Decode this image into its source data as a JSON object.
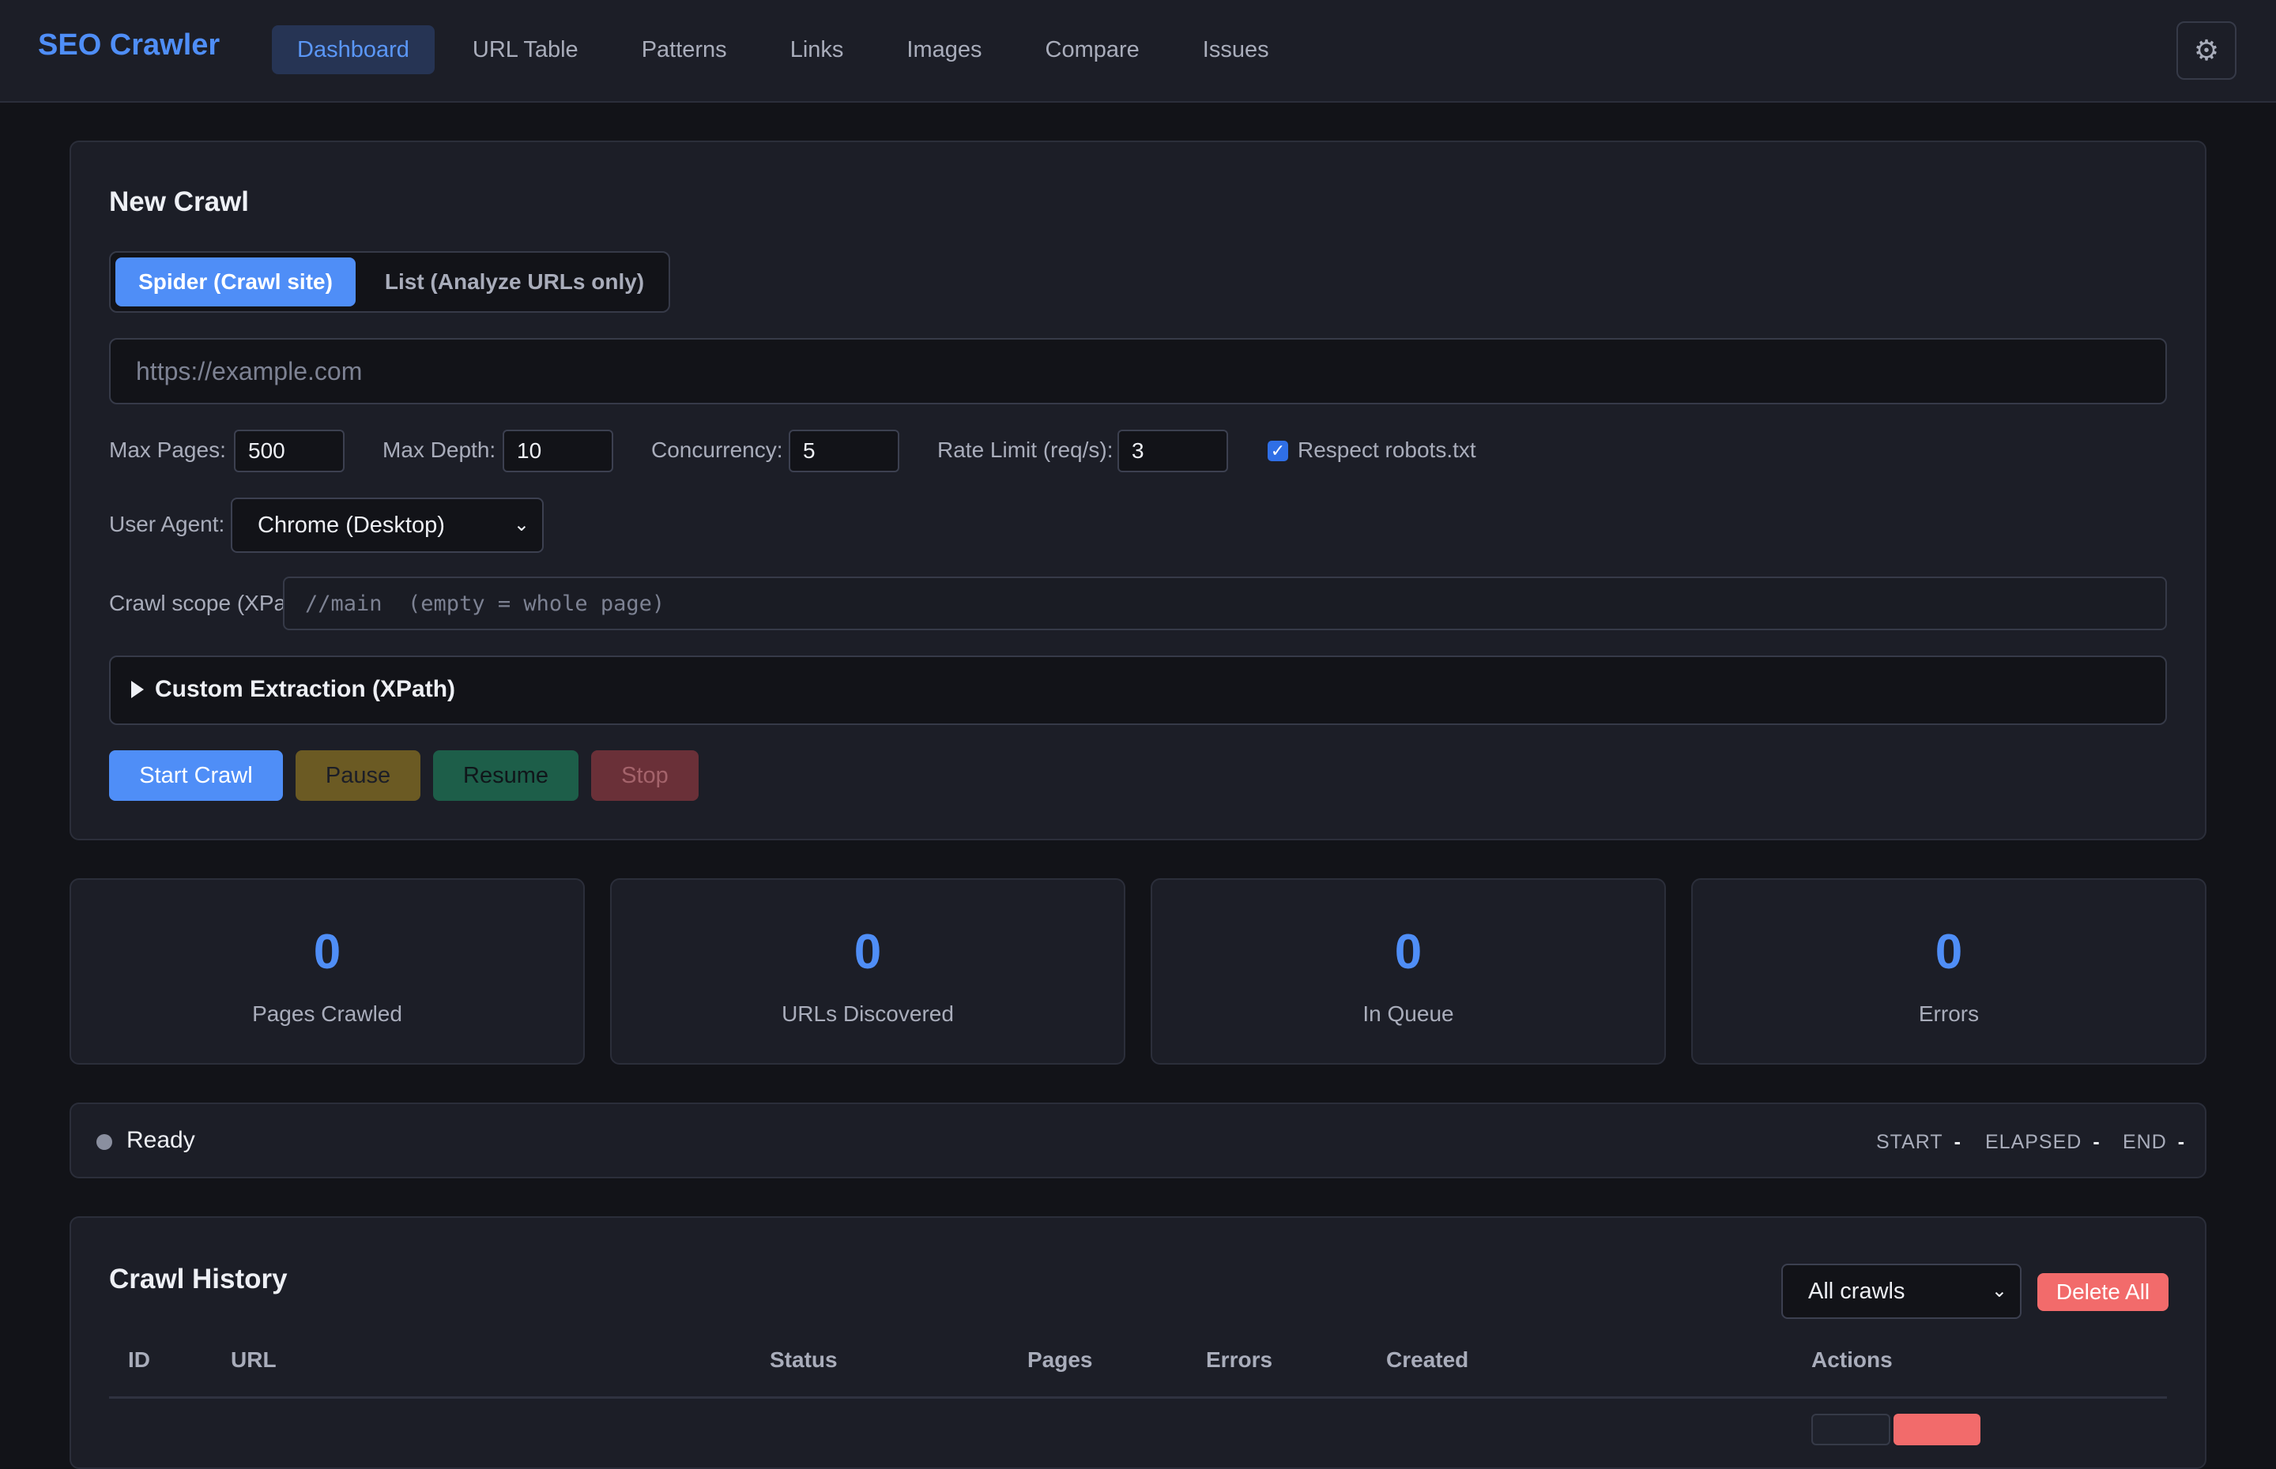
{
  "header": {
    "brand": "SEO Crawler",
    "nav": [
      {
        "label": "Dashboard",
        "active": true
      },
      {
        "label": "URL Table"
      },
      {
        "label": "Patterns"
      },
      {
        "label": "Links"
      },
      {
        "label": "Images"
      },
      {
        "label": "Compare"
      },
      {
        "label": "Issues"
      }
    ],
    "settings_icon": "gear-icon"
  },
  "new_crawl": {
    "title": "New Crawl",
    "modes": [
      {
        "label": "Spider (Crawl site)",
        "active": true
      },
      {
        "label": "List (Analyze URLs only)"
      }
    ],
    "url_placeholder": "https://example.com",
    "max_pages_label": "Max Pages:",
    "max_pages": "500",
    "max_depth_label": "Max Depth:",
    "max_depth": "10",
    "concurrency_label": "Concurrency:",
    "concurrency": "5",
    "rate_limit_label": "Rate Limit (req/s):",
    "rate_limit": "3",
    "robots_label": "Respect robots.txt",
    "robots_checked": true,
    "user_agent_label": "User Agent:",
    "user_agent": "Chrome (Desktop)",
    "scope_label": "Crawl scope (XPath):",
    "scope_placeholder": "//main  (empty = whole page)",
    "extraction_label": "Custom Extraction (XPath)",
    "buttons": {
      "start": "Start Crawl",
      "pause": "Pause",
      "resume": "Resume",
      "stop": "Stop"
    }
  },
  "stats": [
    {
      "value": "0",
      "label": "Pages Crawled"
    },
    {
      "value": "0",
      "label": "URLs Discovered"
    },
    {
      "value": "0",
      "label": "In Queue"
    },
    {
      "value": "0",
      "label": "Errors"
    }
  ],
  "status": {
    "text": "Ready",
    "start_label": "START",
    "start_value": "-",
    "elapsed_label": "ELAPSED",
    "elapsed_value": "-",
    "end_label": "END",
    "end_value": "-"
  },
  "history": {
    "title": "Crawl History",
    "filter": "All crawls",
    "delete_all": "Delete All",
    "columns": [
      "ID",
      "URL",
      "Status",
      "Pages",
      "Errors",
      "Created",
      "Actions"
    ]
  },
  "colors": {
    "accent": "#4f8ef7",
    "background": "#121318",
    "card": "#1c1e27",
    "danger": "#f26b6b"
  }
}
